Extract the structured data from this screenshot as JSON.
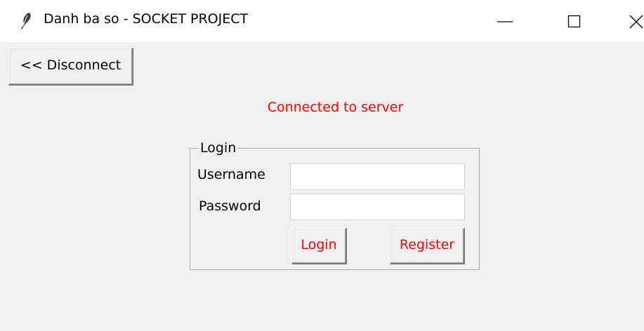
{
  "window": {
    "title": "Danh ba so - SOCKET PROJECT",
    "icon": "feather-icon",
    "controls": [
      "minimize-icon",
      "maximize-icon",
      "close-icon"
    ]
  },
  "toolbar": {
    "disconnect_label": "<< Disconnect"
  },
  "status": {
    "text": "Connected to server",
    "color": "#ff0000"
  },
  "login_form": {
    "group_title": "Login",
    "username_label": "Username",
    "username_value": "",
    "password_label": "Password",
    "password_value": "",
    "login_label": "Login",
    "register_label": "Register"
  },
  "colors": {
    "client_background": "#f0f0f0",
    "accent_text": "#ff0000"
  }
}
